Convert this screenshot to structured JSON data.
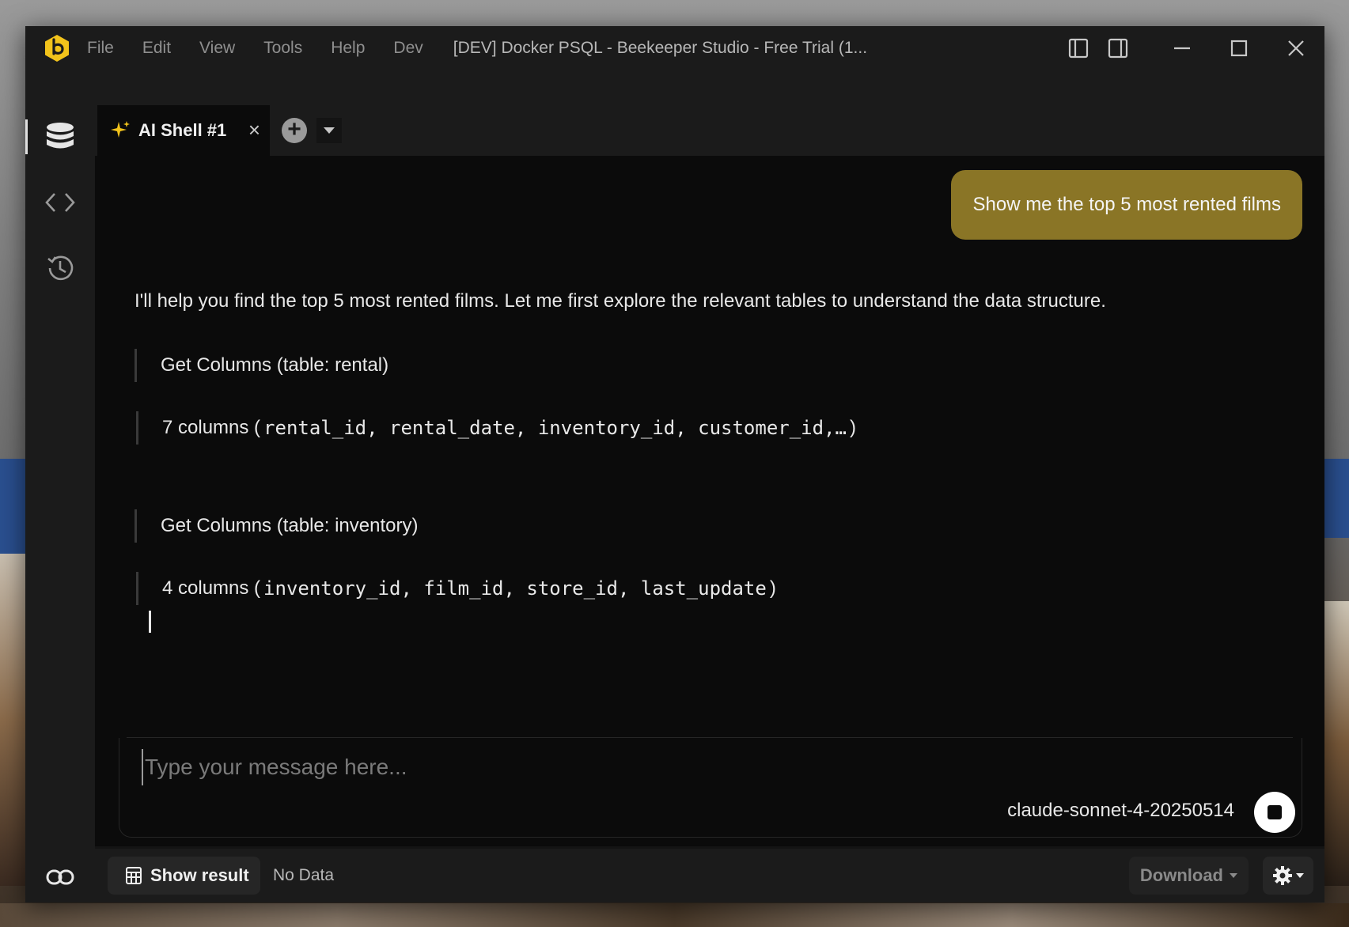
{
  "titlebar": {
    "menu": [
      "File",
      "Edit",
      "View",
      "Tools",
      "Help",
      "Dev"
    ],
    "window_title": "[DEV] Docker PSQL - Beekeeper Studio - Free Trial (1..."
  },
  "tabs": [
    {
      "label": "AI Shell #1",
      "icon": "sparkle-icon",
      "active": true
    }
  ],
  "chat": {
    "user_message": "Show me the top 5 most rented films",
    "assistant_intro": "I'll help you find the top 5 most rented films. Let me first explore the relevant tables to understand the data structure.",
    "tool_calls": [
      {
        "call": "Get Columns (table: rental)",
        "result_prefix": "7 columns (",
        "result_columns": "rental_id, rental_date, inventory_id, customer_id,…",
        "result_suffix": ")"
      },
      {
        "call": "Get Columns (table: inventory)",
        "result_prefix": "4 columns (",
        "result_columns": "inventory_id, film_id, store_id, last_update",
        "result_suffix": ")"
      }
    ]
  },
  "composer": {
    "placeholder": "Type your message here...",
    "model": "claude-sonnet-4-20250514"
  },
  "statusbar": {
    "show_result": "Show result",
    "no_data": "No Data",
    "download": "Download"
  },
  "colors": {
    "accent_logo": "#f2c31b",
    "user_bubble": "#8a7526",
    "background": "#0b0b0b",
    "chrome": "#1b1b1b"
  }
}
